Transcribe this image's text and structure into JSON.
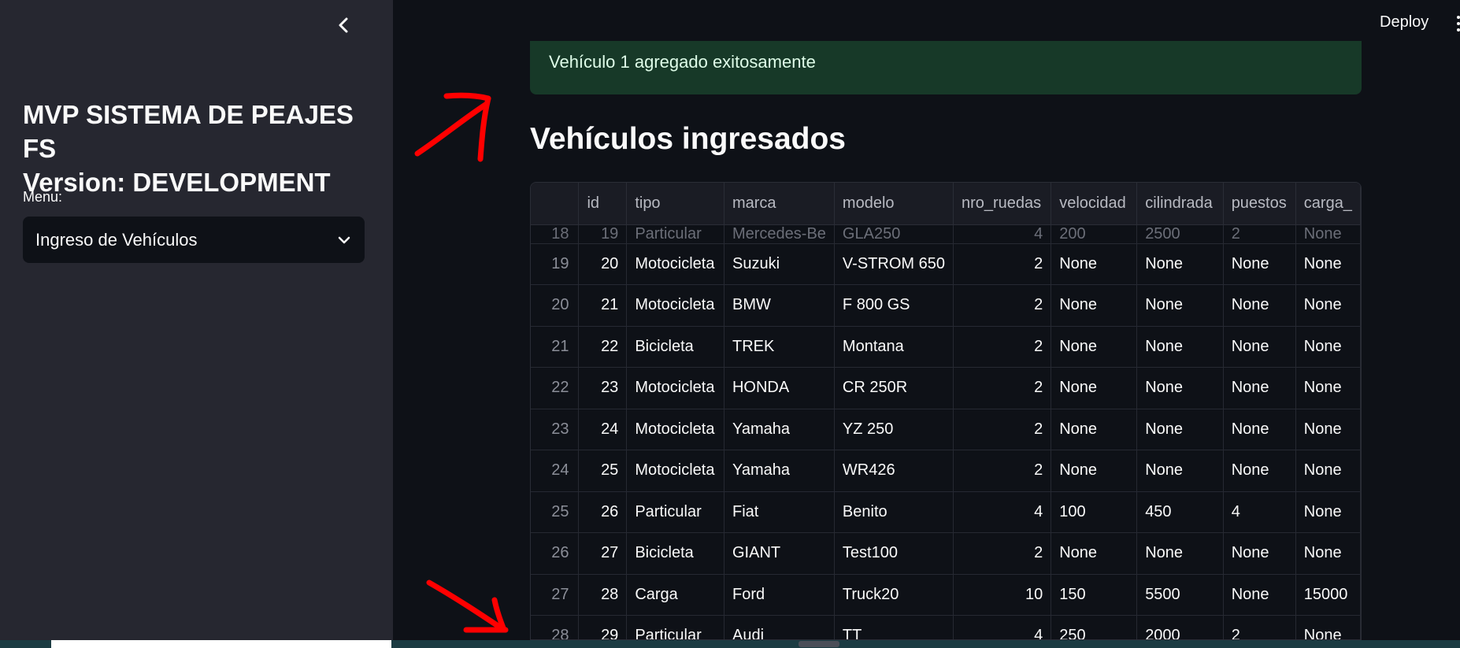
{
  "header": {
    "deploy_label": "Deploy"
  },
  "sidebar": {
    "title_line1": "MVP SISTEMA DE PEAJES FS",
    "title_line2": "Version: DEVELOPMENT",
    "menu_label": "Menu:",
    "menu_selected": "Ingreso de Vehículos"
  },
  "main": {
    "alert_text": "Vehículo 1 agregado exitosamente",
    "heading": "Vehículos ingresados",
    "table": {
      "columns": [
        "",
        "id",
        "tipo",
        "marca",
        "modelo",
        "nro_ruedas",
        "velocidad",
        "cilindrada",
        "puestos",
        "carga_"
      ],
      "partial_row": [
        "18",
        "19",
        "Particular",
        "Mercedes-Be",
        "GLA250",
        "4",
        "200",
        "2500",
        "2",
        "None"
      ],
      "rows": [
        [
          "19",
          "20",
          "Motocicleta",
          "Suzuki",
          "V-STROM 650",
          "2",
          "None",
          "None",
          "None",
          "None"
        ],
        [
          "20",
          "21",
          "Motocicleta",
          "BMW",
          "F 800 GS",
          "2",
          "None",
          "None",
          "None",
          "None"
        ],
        [
          "21",
          "22",
          "Bicicleta",
          "TREK",
          "Montana",
          "2",
          "None",
          "None",
          "None",
          "None"
        ],
        [
          "22",
          "23",
          "Motocicleta",
          "HONDA",
          "CR 250R",
          "2",
          "None",
          "None",
          "None",
          "None"
        ],
        [
          "23",
          "24",
          "Motocicleta",
          "Yamaha",
          "YZ 250",
          "2",
          "None",
          "None",
          "None",
          "None"
        ],
        [
          "24",
          "25",
          "Motocicleta",
          "Yamaha",
          "WR426",
          "2",
          "None",
          "None",
          "None",
          "None"
        ],
        [
          "25",
          "26",
          "Particular",
          "Fiat",
          "Benito",
          "4",
          "100",
          "450",
          "4",
          "None"
        ],
        [
          "26",
          "27",
          "Bicicleta",
          "GIANT",
          "Test100",
          "2",
          "None",
          "None",
          "None",
          "None"
        ],
        [
          "27",
          "28",
          "Carga",
          "Ford",
          "Truck20",
          "10",
          "150",
          "5500",
          "None",
          "15000"
        ],
        [
          "28",
          "29",
          "Particular",
          "Audi",
          "TT",
          "4",
          "250",
          "2000",
          "2",
          "None"
        ]
      ]
    }
  },
  "icons": {
    "collapse": "chevron-left-icon",
    "select": "chevron-down-icon",
    "menu": "more-vertical-icon"
  },
  "colors": {
    "sidebar_bg": "#262730",
    "main_bg": "#0e1117",
    "alert_bg": "#173928",
    "annotation": "#ff0000"
  }
}
